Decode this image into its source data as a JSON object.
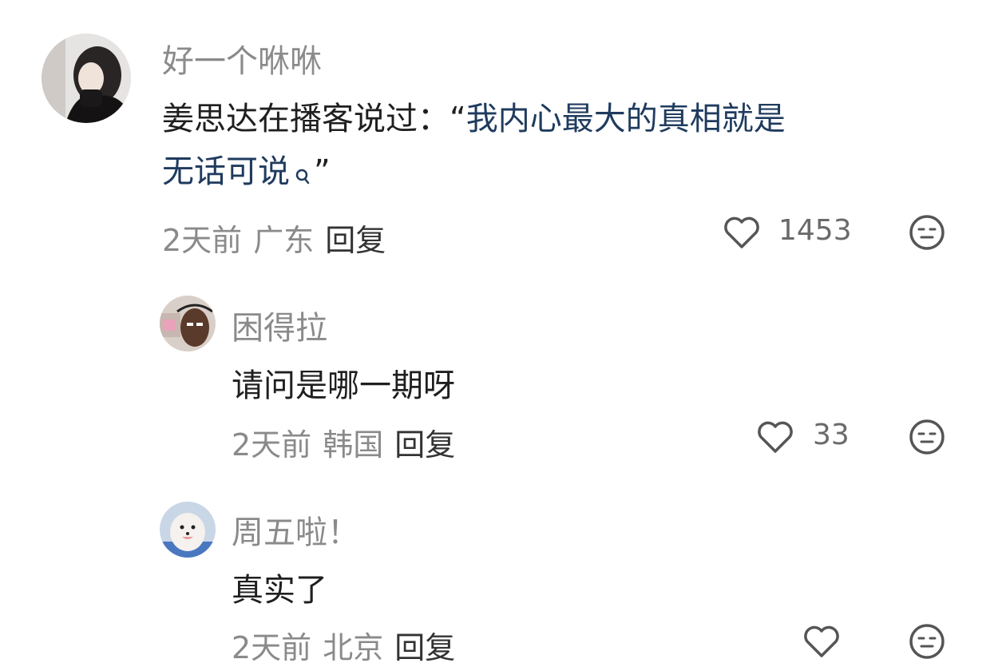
{
  "comments": [
    {
      "username": "好一个咻咻",
      "text_before_topic": "姜思达在播客说过：“",
      "topic_line1": "我内心最大的真相就是",
      "topic_line2": "无话可说",
      "text_after_topic": "”",
      "time": "2天前",
      "location": "广东",
      "reply_label": "回复",
      "like_count": "1453",
      "avatar_icon": "woman-portrait-avatar",
      "like_icon": "heart-outline-icon",
      "emoji_icon": "neutral-face-icon"
    },
    {
      "username": "困得拉",
      "text": "请问是哪一期呀",
      "time": "2天前",
      "location": "韩国",
      "reply_label": "回复",
      "like_count": "33",
      "avatar_icon": "man-selfie-avatar",
      "like_icon": "heart-outline-icon",
      "emoji_icon": "neutral-face-icon"
    },
    {
      "username": "周五啦！",
      "text": "真实了",
      "time": "2天前",
      "location": "北京",
      "reply_label": "回复",
      "like_count": "",
      "avatar_icon": "white-dog-avatar",
      "like_icon": "heart-outline-icon",
      "emoji_icon": "neutral-face-icon"
    }
  ],
  "colors": {
    "topic_link": "#1f3b5e",
    "username": "#8a8a8a",
    "body": "#1f1f1f",
    "meta": "#8a8a8a"
  }
}
